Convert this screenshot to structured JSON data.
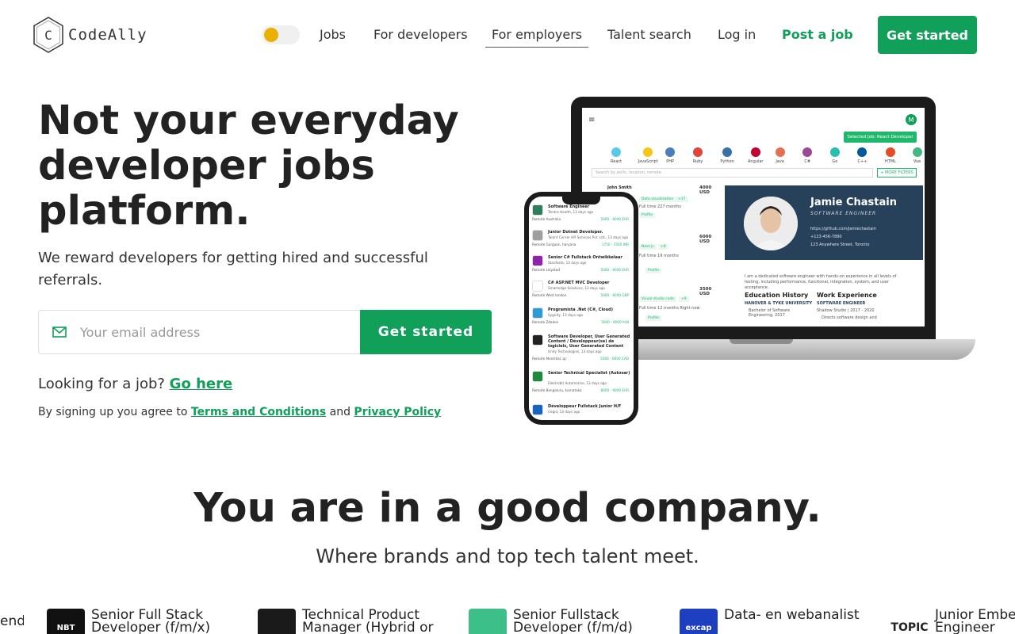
{
  "header": {
    "logo_letter": "C",
    "logo_text": "CodeAlly",
    "nav": {
      "jobs": "Jobs",
      "for_developers": "For developers",
      "for_employers": "For employers",
      "talent_search": "Talent search",
      "log_in": "Log in",
      "post_job": "Post a job"
    },
    "get_started": "Get started",
    "theme_toggle_state": "light"
  },
  "hero": {
    "title": "Not your everyday developer jobs platform.",
    "subtitle": "We reward developers for getting hired and successful referrals.",
    "email_placeholder": "Your email address",
    "cta": "Get started",
    "looking_prefix": "Looking for a job?",
    "looking_link": "Go here",
    "terms_prefix": "By signing up you agree to",
    "terms_link": "Terms and Conditions",
    "terms_and": "and",
    "privacy_link": "Privacy Policy"
  },
  "laptop_screen": {
    "selected_job": "Selected Job: React Developer",
    "avatar_letter": "M",
    "technologies": [
      "React",
      "JavaScript",
      "PHP",
      "Ruby",
      "Python",
      "Angular",
      "Java",
      "C#",
      "Go",
      "C++",
      "HTML",
      "Vue"
    ],
    "tech_colors": [
      "#5bc8e8",
      "#f5c518",
      "#4a7ebf",
      "#e0453a",
      "#3572A5",
      "#c3002f",
      "#e76f51",
      "#9b4993",
      "#29beb0",
      "#00599c",
      "#e44d26",
      "#41b883"
    ],
    "search_placeholder": "Search by skills, location, remote",
    "more_filters": "+ MORE FILTERS",
    "list": [
      {
        "name": "John Smith",
        "salary": "4000 USD",
        "tag": "Data visualization",
        "extra": "+17",
        "meta": "Full time  227 months",
        "profile": "Profile"
      },
      {
        "name": "",
        "salary": "6000 USD",
        "tag": "Next.js",
        "extra": "+8",
        "meta": "Full time  19 months",
        "profile": "Profile"
      },
      {
        "name": "",
        "salary": "3500 USD",
        "tag": "Visual studio code",
        "extra": "+9",
        "meta": "Full time  12 months  Right now",
        "profile": "Profile"
      }
    ],
    "card": {
      "name": "Jamie Chastain",
      "role": "SOFTWARE ENGINEER",
      "github": "https://github.com/jamiechastain",
      "phone": "+123-456-7890",
      "address": "123 Anywhere Street, Toronto"
    },
    "about": "I am a dedicated software engineer with hands-on experience in all levels of testing, including performance, functional, integration, system, and user acceptance.",
    "education_title": "Education History",
    "education_school": "HANOVER & TYKE UNIVERSITY",
    "education_degree": "Bachelor of Software Engineering, 2017",
    "experience_title": "Work Experience",
    "experience_role": "SOFTWARE ENGINEER",
    "experience_company": "Shadow Studio | 2017 - 2020",
    "experience_note": "Directs software design and"
  },
  "phone_screen": {
    "jobs": [
      {
        "title": "Software Engineer",
        "company": "Telstra Health, 13 days ago",
        "location": "Remote  Australia",
        "salary": "5000 - 6000 EUR",
        "color": "#2e7d5b"
      },
      {
        "title": "Junior Dotnet Developer.",
        "company": "Talent Corner HR Services Pvt. Ltd., 13 days ago",
        "location": "Remote  Gurgaon, haryana",
        "salary": "1750 - 2500 INR",
        "color": "#9e9e9e"
      },
      {
        "title": "Senior C# Fullstack Ontwikkelaar",
        "company": "Stanfaste, 13 days ago",
        "location": "Remote  Lelystad",
        "salary": "5000 - 6000 EUR",
        "color": "#8e24aa"
      },
      {
        "title": "C# ASP.NET MVC Developer",
        "company": "Smartedge Solutions, 13 days ago",
        "location": "Remote  West london",
        "salary": "5000 - 6000 GBP",
        "color": "#ffffff"
      },
      {
        "title": "Programista .Net (C#, Cloud)",
        "company": "Sygnity, 13 days ago",
        "location": "Remote  Zdalnie",
        "salary": "5000 - 6000 PLN",
        "color": "#2e9bd6"
      },
      {
        "title": "Software Developer, User Generated Content / Développeur(se) de logiciels, User Generated Content",
        "company": "Unity Technologies, 13 days ago",
        "location": "Remote  Montréal, qc",
        "salary": "5000 - 6000 CAD",
        "color": "#222222"
      },
      {
        "title": "Senior Technical Specialist (Autosar)",
        "company": "Elektrobit Automotive, 13 days ago",
        "location": "Remote  Bengaluru, karnataka",
        "salary": "8000 - 9000 EUR",
        "color": "#1e8a3e"
      },
      {
        "title": "Développeur Fullstack Junior H/F",
        "company": "Cegid, 13 days ago",
        "location": "",
        "salary": "",
        "color": "#1565c0"
      }
    ]
  },
  "section_company": {
    "title": "You are in a good company.",
    "subtitle": "Where brands and top tech talent meet.",
    "partial_left_text": "end",
    "jobs": [
      {
        "title": "Senior Full Stack Developer (f/m/x)",
        "logo_text": "NBT",
        "logo_bg": "#111111"
      },
      {
        "title": "Technical Product Manager (Hybrid or",
        "logo_text": "",
        "logo_bg": "#1a1a1a"
      },
      {
        "title": "Senior Fullstack Developer (f/m/d)",
        "logo_text": "",
        "logo_bg": "#3dbf8a"
      },
      {
        "title": "Data- en webanalist",
        "logo_text": "excap",
        "logo_bg": "#1e3fbf"
      },
      {
        "title": "Junior Embedded Engineer",
        "logo_text": "TOPIC",
        "logo_bg": "#ffffff"
      }
    ]
  },
  "colors": {
    "brand_green": "#10a05a",
    "toggle_knob": "#ecb000",
    "card_navy": "#27415a"
  }
}
